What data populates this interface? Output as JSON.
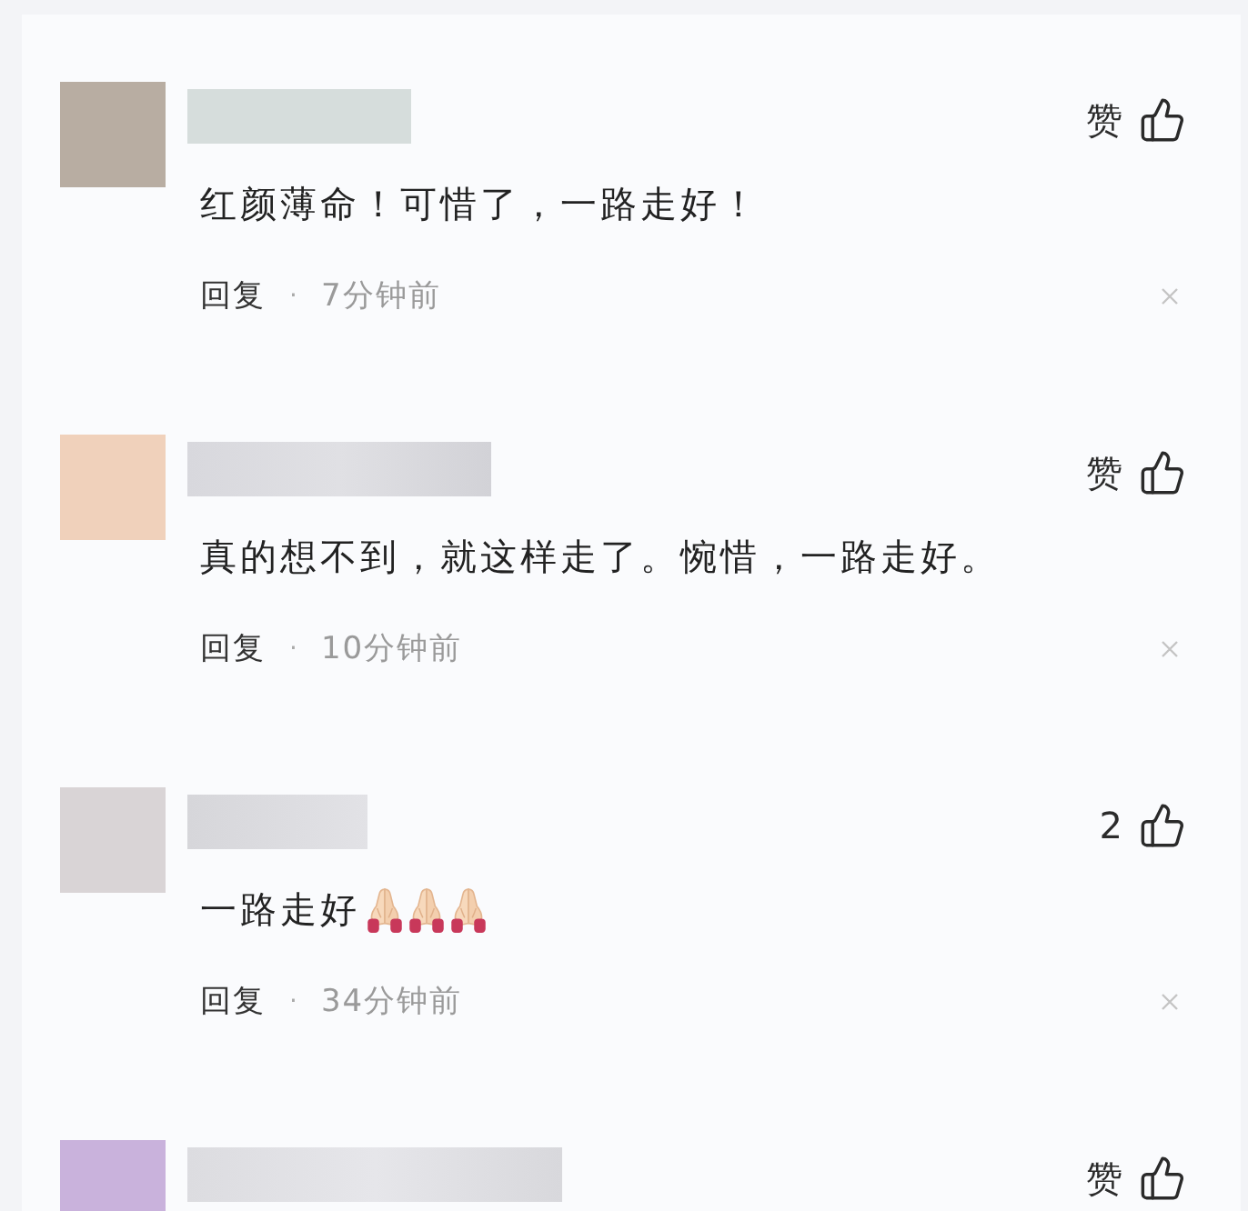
{
  "comments": [
    {
      "avatar": {
        "color": "#b8ada2"
      },
      "text": "红颜薄命！可惜了，一路走好！",
      "like": "赞",
      "reply": "回复",
      "separator": "·",
      "time": "7分钟前"
    },
    {
      "avatar": {
        "color": "#f0d1bb"
      },
      "text": "真的想不到，就这样走了。惋惜，一路走好。",
      "like": "赞",
      "reply": "回复",
      "separator": "·",
      "time": "10分钟前"
    },
    {
      "avatar": {
        "color": "#d9d4d6"
      },
      "text": "一路走好",
      "emojis": [
        {
          "kind": "praying-hands"
        },
        {
          "kind": "praying-hands"
        },
        {
          "kind": "praying-hands"
        }
      ],
      "like": "2",
      "reply": "回复",
      "separator": "·",
      "time": "34分钟前"
    },
    {
      "avatar": {
        "color": "#c9b2dc"
      },
      "like": "赞"
    }
  ]
}
